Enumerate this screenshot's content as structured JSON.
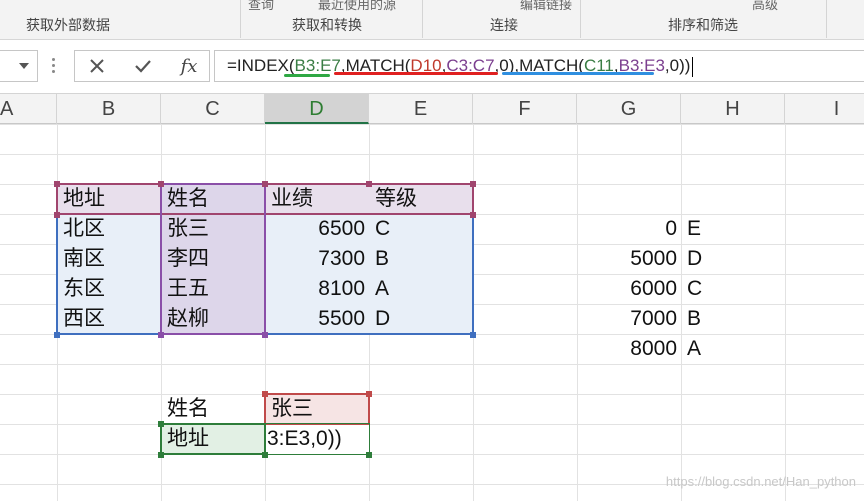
{
  "ribbon": {
    "top_labels": [
      "查询",
      "最近使用的源",
      "编辑链接",
      "高级"
    ],
    "groups": [
      "获取外部数据",
      "获取和转换",
      "连接",
      "排序和筛选"
    ]
  },
  "formula_bar": {
    "cancel_icon": "close-icon",
    "enter_icon": "check-icon",
    "fx_label": "fx",
    "formula": {
      "p1": "=INDEX(",
      "r1": "B3:E7",
      "p2": ",MATCH(",
      "r2": "D10",
      "p3": ",",
      "r3": "C3:C7",
      "p4": ",0),MATCH(",
      "r4": "C11",
      "p5": ",",
      "r5": "B3:E3",
      "p6": ",0))"
    },
    "underline_colors": [
      "#2ea843",
      "#e02020",
      "#2f8fe0"
    ]
  },
  "columns": [
    "A",
    "B",
    "C",
    "D",
    "E",
    "F",
    "G",
    "H",
    "I"
  ],
  "table": {
    "headers": [
      "地址",
      "姓名",
      "业绩",
      "等级"
    ],
    "rows": [
      [
        "北区",
        "张三",
        "6500",
        "C"
      ],
      [
        "南区",
        "李四",
        "7300",
        "B"
      ],
      [
        "东区",
        "王五",
        "8100",
        "A"
      ],
      [
        "西区",
        "赵柳",
        "5500",
        "D"
      ]
    ]
  },
  "lookup": {
    "thresholds": [
      "0",
      "5000",
      "6000",
      "7000",
      "8000"
    ],
    "grades": [
      "E",
      "D",
      "C",
      "B",
      "A"
    ]
  },
  "query": {
    "name_label": "姓名",
    "name_value": "张三",
    "addr_label": "地址",
    "addr_edit": "3:E3,0))"
  },
  "watermark": "https://blog.csdn.net/Han_python",
  "colors": {
    "purple_ref": "#a0456e",
    "blue_ref": "#3f6fbf",
    "red_ref": "#c04a4a",
    "green_ref": "#2e7d3a"
  }
}
